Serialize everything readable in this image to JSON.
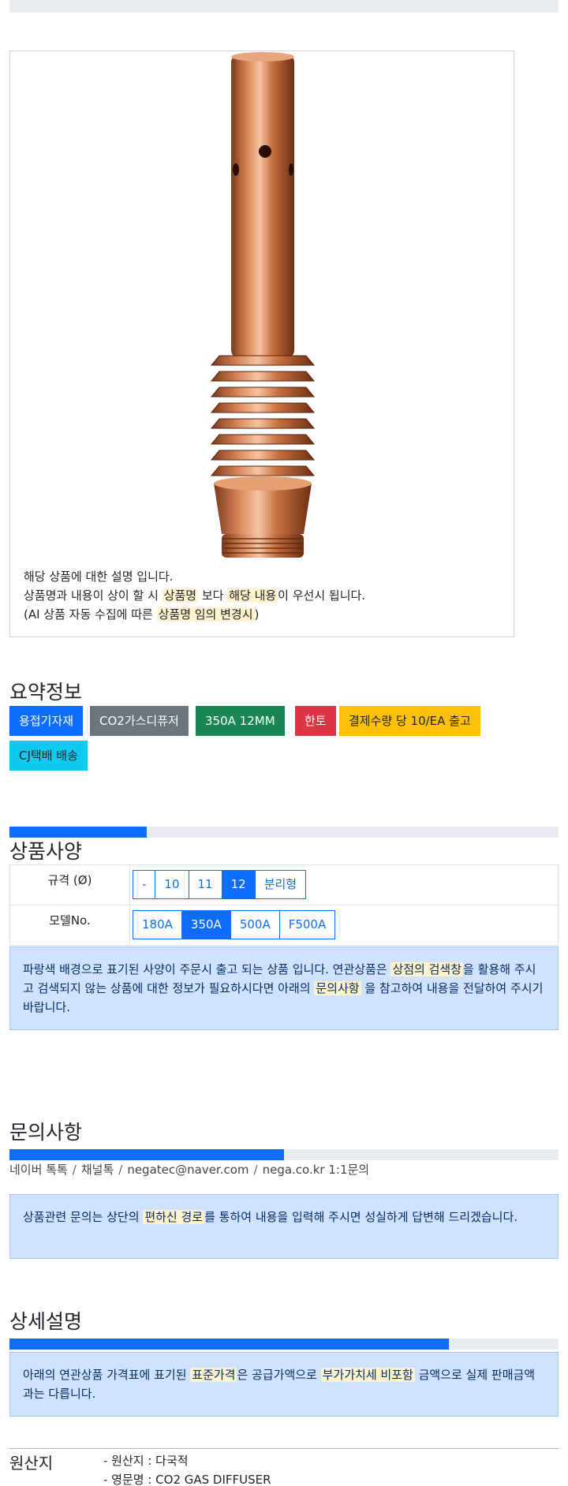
{
  "description": {
    "line1": "해당 상품에 대한 설명 입니다.",
    "line2_a": "상품명과 내용이 상이 할 시 ",
    "line2_h1": "상품명",
    "line2_b": " 보다 ",
    "line2_h2": "해당 내용",
    "line2_c": "이 우선시 됩니다.",
    "line3_a": "(AI 상품 자동 수집에 따른 ",
    "line3_h": "상품명 임의 변경시",
    "line3_b": ")"
  },
  "summary": {
    "title": "요약정보",
    "tags": [
      {
        "label": "용접기자재",
        "color": "#0d6efd"
      },
      {
        "label": "CO2가스디퓨저",
        "color": "#6c757d"
      },
      {
        "label": "350A 12MM",
        "color": "#198754"
      },
      {
        "label": "한토",
        "color": "#dc3545"
      },
      {
        "label": "결제수량 당 10/EA 출고",
        "color": "#ffc107"
      },
      {
        "label": "CJ택배 배송",
        "color": "#0dcaf0"
      }
    ]
  },
  "spec": {
    "title": "상품사양",
    "progress": 0.25,
    "rows": [
      {
        "label": "규격 (Ø)",
        "options": [
          "-",
          "10",
          "11",
          "12",
          "분리형"
        ],
        "active": "12"
      },
      {
        "label": "모델No.",
        "options": [
          "180A",
          "350A",
          "500A",
          "F500A"
        ],
        "active": "350A"
      }
    ],
    "notice_a": "파랑색 배경으로 표기된 사양이 주문시 출고 되는 상품 입니다. 연관상품은 ",
    "notice_h1": "상점의 검색창",
    "notice_b": "을 활용해 주시고 검색되지 않는 상품에 대한 정보가 필요하시다면 아래의 ",
    "notice_h2": "문의사항",
    "notice_c": " 을 참고하여 내용을 전달하여 주시기 바랍니다."
  },
  "inquiry": {
    "title": "문의사항",
    "progress": 0.5,
    "contacts": [
      "네이버 톡톡",
      "채널톡",
      "negatec@naver.com",
      "nega.co.kr 1:1문의"
    ],
    "notice_a": "상품관련 문의는 상단의 ",
    "notice_h": "편하신 경로",
    "notice_b": "를 통하여 내용을 입력해 주시면 성실하게 답변해 드리겠습니다."
  },
  "detail": {
    "title": "상세설명",
    "progress": 0.8,
    "notice_a": "아래의 연관상품 가격표에 표기된 ",
    "notice_h1": "표준가격",
    "notice_b": "은 공급가액으로 ",
    "notice_h2": "부가가치세 비포함",
    "notice_c": " 금액으로 실제 판매금액과는 다릅니다."
  },
  "origin": {
    "label": "원산지",
    "line1": "- 원산지 : 다국적",
    "line2": "- 영문명 : CO2 GAS DIFFUSER"
  }
}
